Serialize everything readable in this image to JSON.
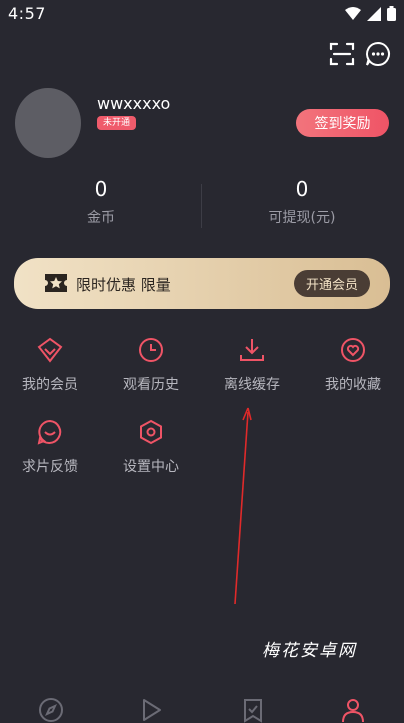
{
  "status_bar": {
    "time": "4:57"
  },
  "profile": {
    "username": "wwxxxxo",
    "badge": "未开通",
    "checkin_label": "签到奖励"
  },
  "stats": [
    {
      "value": "0",
      "label": "金币"
    },
    {
      "value": "0",
      "label": "可提现(元)"
    }
  ],
  "vip_banner": {
    "text": "限时优惠 限量",
    "button_label": "开通会员"
  },
  "menu": [
    {
      "label": "我的会员",
      "icon": "diamond-icon"
    },
    {
      "label": "观看历史",
      "icon": "clock-icon"
    },
    {
      "label": "离线缓存",
      "icon": "download-icon"
    },
    {
      "label": "我的收藏",
      "icon": "heart-icon"
    },
    {
      "label": "求片反馈",
      "icon": "feedback-icon"
    },
    {
      "label": "设置中心",
      "icon": "settings-icon"
    }
  ],
  "watermark": "梅花安卓网",
  "colors": {
    "accent": "#ef5466",
    "background": "#282830",
    "gold": "#e8d3b0"
  }
}
